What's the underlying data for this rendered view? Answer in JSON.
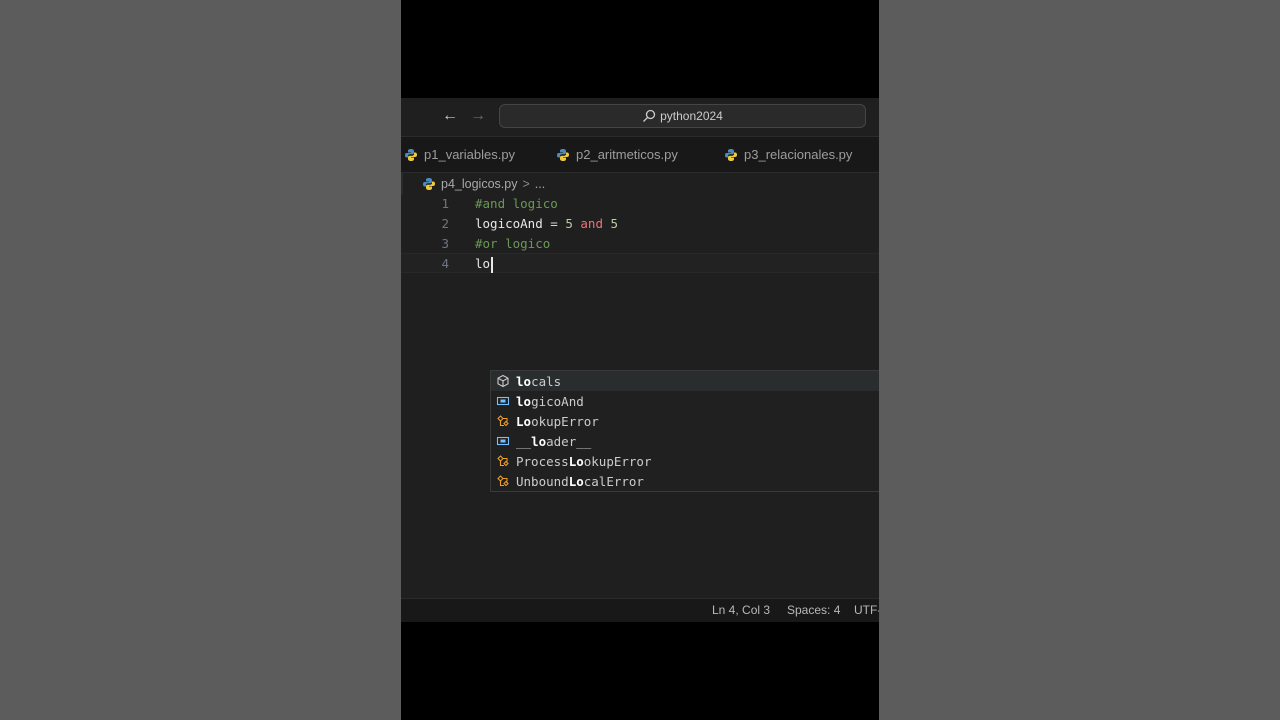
{
  "window": {
    "search_text": "python2024"
  },
  "tabs": [
    {
      "label": "p1_variables.py"
    },
    {
      "label": "p2_aritmeticos.py"
    },
    {
      "label": "p3_relacionales.py"
    }
  ],
  "breadcrumb": {
    "file": "p4_logicos.py",
    "separator": ">",
    "more": "..."
  },
  "editor": {
    "lines": [
      {
        "number": "1"
      },
      {
        "number": "2"
      },
      {
        "number": "3"
      },
      {
        "number": "4"
      }
    ],
    "line1_comment": "#and logico",
    "line2_ident": "logicoAnd",
    "line2_eq": "=",
    "line2_num1": "5",
    "line2_kw": "and",
    "line2_num2": "5",
    "line3_comment": "#or logico",
    "line4_typed": "lo"
  },
  "suggestions": [
    {
      "match": "lo",
      "rest": "cals",
      "pre": "",
      "kind": "module-icon"
    },
    {
      "match": "lo",
      "rest": "gicoAnd",
      "pre": "",
      "kind": "variable-icon"
    },
    {
      "match": "Lo",
      "rest": "okupError",
      "pre": "",
      "kind": "class-icon"
    },
    {
      "match": "lo",
      "rest": "ader__",
      "pre": "__",
      "kind": "variable-icon"
    },
    {
      "match": "Lo",
      "rest": "okupError",
      "pre": "Process",
      "kind": "class-icon"
    },
    {
      "match": "Lo",
      "rest": "calError",
      "pre": "Unbound",
      "kind": "class-icon"
    }
  ],
  "statusbar": {
    "position": "Ln 4, Col 3",
    "spaces": "Spaces: 4",
    "encoding": "UTF-"
  },
  "colors": {
    "comment": "#6a9955",
    "keyword": "#f07178",
    "number": "#b5cea8",
    "class_icon": "#ee9d28",
    "variable_icon": "#75beff"
  }
}
